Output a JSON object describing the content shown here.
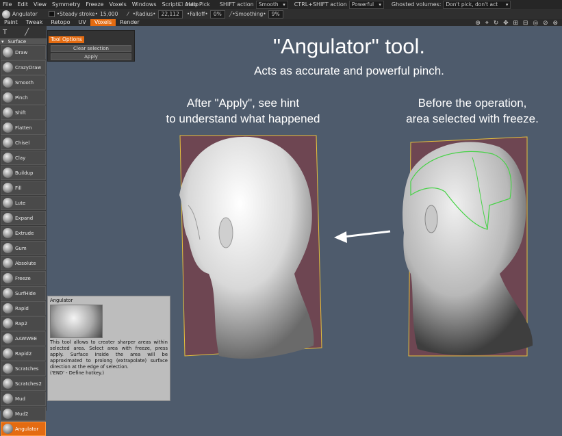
{
  "menubar": {
    "items": [
      "File",
      "Edit",
      "View",
      "Symmetry",
      "Freeze",
      "Voxels",
      "Windows",
      "Scripts",
      "Help"
    ],
    "auto_pick": "Auto Pick",
    "shift_action_label": "SHIFT action",
    "shift_action_value": "Smooth",
    "ctrl_shift_label": "CTRL+SHIFT action",
    "ctrl_shift_value": "Powerful",
    "ghosted_label": "Ghosted volumes:",
    "ghosted_value": "Don't pick, don't act"
  },
  "toolbar": {
    "tool_name": "Angulator",
    "steady_label": "•Steady stroke•",
    "steady_value": "15,000",
    "radius_label": "•Radius•",
    "radius_value": "22,112",
    "falloff_label": "•Falloff•",
    "falloff_value": "0%",
    "smoothing_label": "•Smoothing•",
    "smoothing_value": "9%"
  },
  "tabs": [
    {
      "label": "Paint"
    },
    {
      "label": "Tweak"
    },
    {
      "label": "Retopo"
    },
    {
      "label": "UV"
    },
    {
      "label": "Voxels",
      "active": true
    },
    {
      "label": "Render"
    }
  ],
  "toolbar_right_icons": "⊕ ⌖ ↻ ✥ ⊞ ⊟ ◎ ⊘ ⊗",
  "left_panel": {
    "section": "Surface",
    "tools": [
      "Draw",
      "CrazyDraw",
      "Smooth",
      "Pinch",
      "Shift",
      "Flatten",
      "Chisel",
      "Clay",
      "Buildup",
      "Fill",
      "Lute",
      "Expand",
      "Extrude",
      "Gum",
      "Absolute",
      "Freeze",
      "SurfHide",
      "Rapid",
      "Rap2",
      "AAWWEE",
      "Rapid2",
      "Scratches",
      "Scratches2",
      "Mud",
      "Mud2",
      "Angulator"
    ],
    "active": "Angulator"
  },
  "tool_options": {
    "header": "Tool Options",
    "clear_button": "Clear selection",
    "apply_button": "Apply"
  },
  "tooltip": {
    "title": "Angulator",
    "description": "This tool allows to creater sharper areas within selected area. Select area with freeze, press apply. Surface inside the area will be approximated to prolong (extrapolate) surface direction at the edge of selection.",
    "hotkey": "('END' - Define hotkey.)"
  },
  "viewport": {
    "title": "\"Angulator\" tool.",
    "subtitle": "Acts as accurate and powerful pinch.",
    "left_caption_1": "After \"Apply\", see hint",
    "left_caption_2": "to understand what happened",
    "right_caption_1": "Before the operation,",
    "right_caption_2": "area selected with freeze."
  },
  "colors": {
    "accent": "#e46b11",
    "viewport_bg": "#4e5b6c",
    "plane": "#6e4652",
    "plane_border": "#e8c23c",
    "freeze_line": "#46d246"
  }
}
